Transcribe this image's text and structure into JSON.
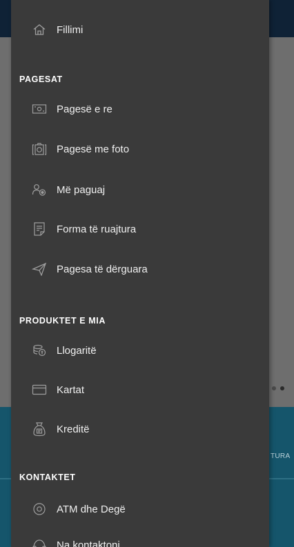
{
  "background": {
    "tab_label": "TURA"
  },
  "drawer": {
    "home": {
      "label": "Fillimi",
      "icon": "home-icon"
    },
    "sections": [
      {
        "title": "PAGESAT",
        "items": [
          {
            "label": "Pagesë e re",
            "icon": "payment-icon"
          },
          {
            "label": "Pagesë me foto",
            "icon": "camera-icon"
          },
          {
            "label": "Më paguaj",
            "icon": "request-payment-icon"
          },
          {
            "label": "Forma të ruajtura",
            "icon": "saved-forms-icon"
          },
          {
            "label": "Pagesa të dërguara",
            "icon": "send-icon"
          }
        ]
      },
      {
        "title": "PRODUKTET E MIA",
        "items": [
          {
            "label": "Llogaritë",
            "icon": "coins-icon"
          },
          {
            "label": "Kartat",
            "icon": "card-icon"
          },
          {
            "label": "Kreditë",
            "icon": "money-bag-icon"
          }
        ]
      },
      {
        "title": "KONTAKTET",
        "items": [
          {
            "label": "ATM dhe Degë",
            "icon": "location-icon"
          },
          {
            "label": "Na kontaktoni",
            "icon": "phone-icon"
          }
        ]
      }
    ]
  },
  "colors": {
    "drawer_bg": "#3a3a3a",
    "icon": "#9e9e9e",
    "text": "#f0f0f0",
    "header_bg": "#0f2236",
    "teal_bg": "#15556b"
  }
}
